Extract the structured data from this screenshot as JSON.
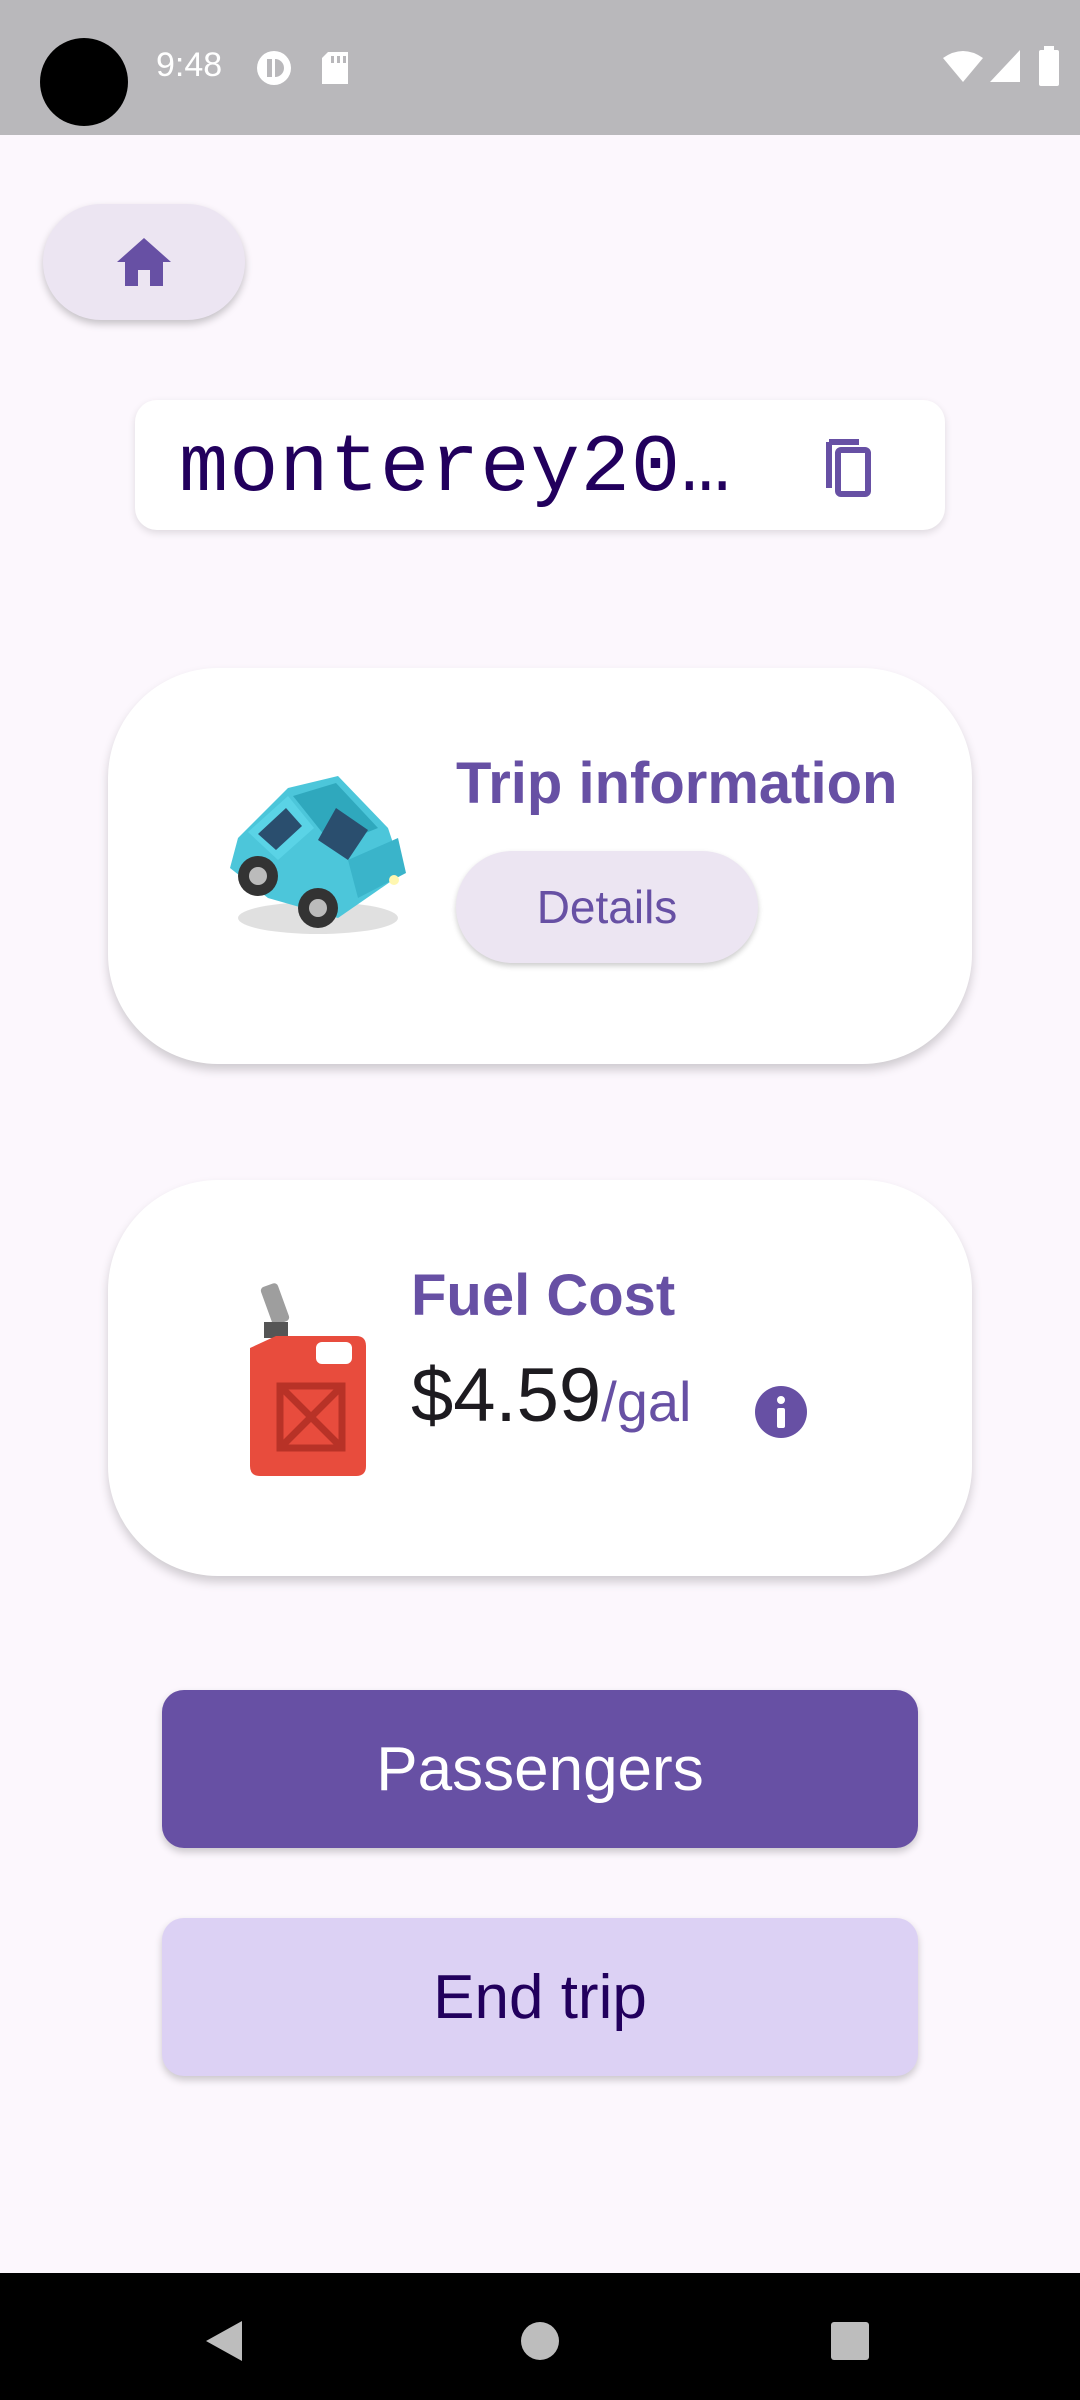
{
  "status_bar": {
    "time": "9:48",
    "icons": [
      "camera-cutout",
      "privacy-indicator-icon",
      "sd-card-icon",
      "wifi-icon",
      "signal-icon",
      "battery-icon"
    ]
  },
  "toolbar": {
    "home_icon": "home-icon"
  },
  "trip_code": {
    "value": "monterey20…",
    "copy_icon": "copy-icon"
  },
  "trip_card": {
    "image": "car-illustration",
    "title": "Trip information",
    "details_label": "Details"
  },
  "fuel_card": {
    "image": "fuel-can-illustration",
    "title": "Fuel Cost",
    "price": "$4.59",
    "unit": "/gal",
    "info_icon": "info-icon"
  },
  "actions": {
    "passengers_label": "Passengers",
    "end_trip_label": "End trip"
  },
  "nav_bar": {
    "icons": [
      "back-icon",
      "home-nav-icon",
      "recents-icon"
    ]
  },
  "colors": {
    "primary": "#6750a4",
    "primary_container": "#dcd1f4",
    "surface": "#fcf7fd",
    "on_primary_container": "#22005d"
  }
}
